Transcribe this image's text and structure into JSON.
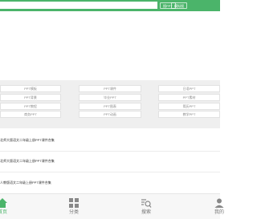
{
  "header": {
    "search_placeholder": "",
    "btn1": "搜PPT",
    "btn2": "模拟搜"
  },
  "grid": [
    [
      "PPT模板",
      "PPT课件",
      "日语PPT"
    ],
    [
      "PPT背景",
      "毕业PPT",
      "PPT素材"
    ],
    [
      "PPT教程",
      "PPT图表",
      "简历PPT"
    ],
    [
      "商务PPT",
      "PPT动画",
      "教学PPT"
    ]
  ],
  "list": [
    "北师大版语文二年级上册PPT课件合集",
    "北师大版语文二年级上册PPT课件合集",
    "人教版语文二年级上册PPT课件合集"
  ],
  "nav": [
    {
      "label": "首页",
      "icon": "home-icon",
      "active": true
    },
    {
      "label": "分类",
      "icon": "grid-icon",
      "active": false
    },
    {
      "label": "搜索",
      "icon": "search-list-icon",
      "active": false
    },
    {
      "label": "我的",
      "icon": "user-icon",
      "active": false
    }
  ],
  "colors": {
    "accent": "#4bb46a",
    "grid_bg": "#efefef"
  }
}
